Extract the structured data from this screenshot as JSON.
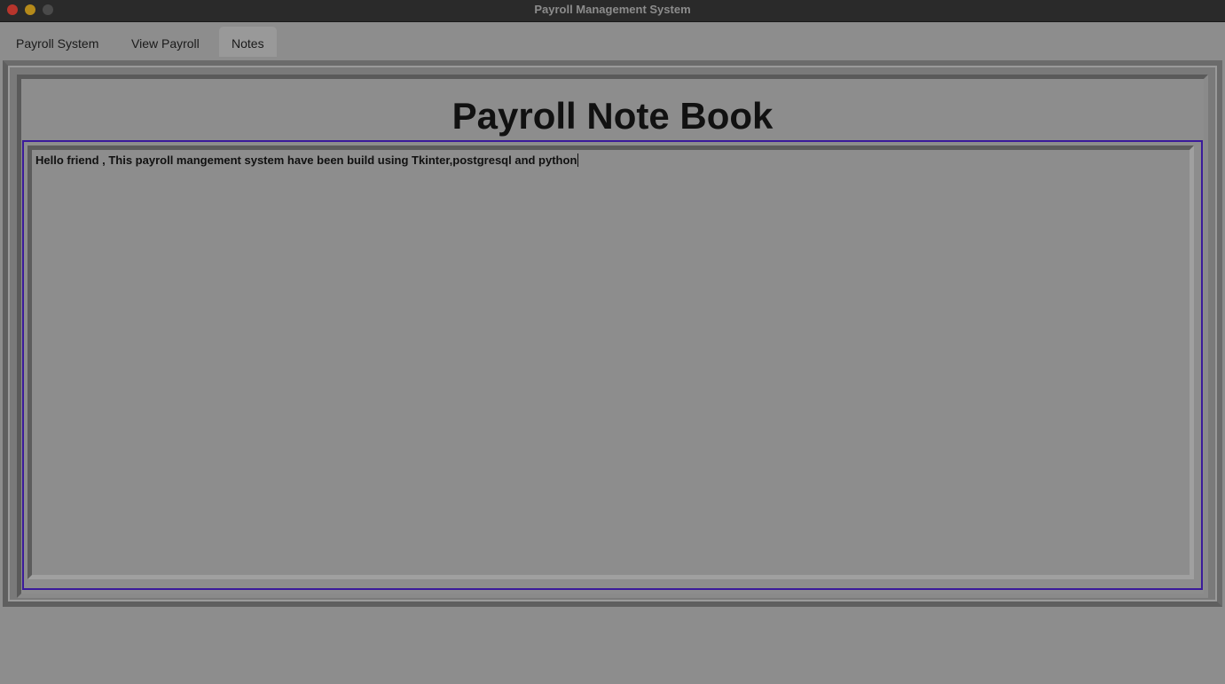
{
  "window": {
    "title": "Payroll Management System"
  },
  "tabs": [
    {
      "label": "Payroll System",
      "active": false
    },
    {
      "label": "View Payroll",
      "active": false
    },
    {
      "label": "Notes",
      "active": true
    }
  ],
  "notes": {
    "heading": "Payroll Note Book",
    "content": "Hello friend , This payroll mangement system have been build using Tkinter,postgresql and python"
  },
  "colors": {
    "background": "#8d8d8d",
    "titlebar": "#2a2a2a",
    "focus_border": "#3a1a9a",
    "close_button": "#b8352c",
    "minimize_button": "#b58a1a"
  },
  "icons": {
    "close": "close-icon",
    "minimize": "minimize-icon",
    "maximize": "maximize-icon"
  }
}
